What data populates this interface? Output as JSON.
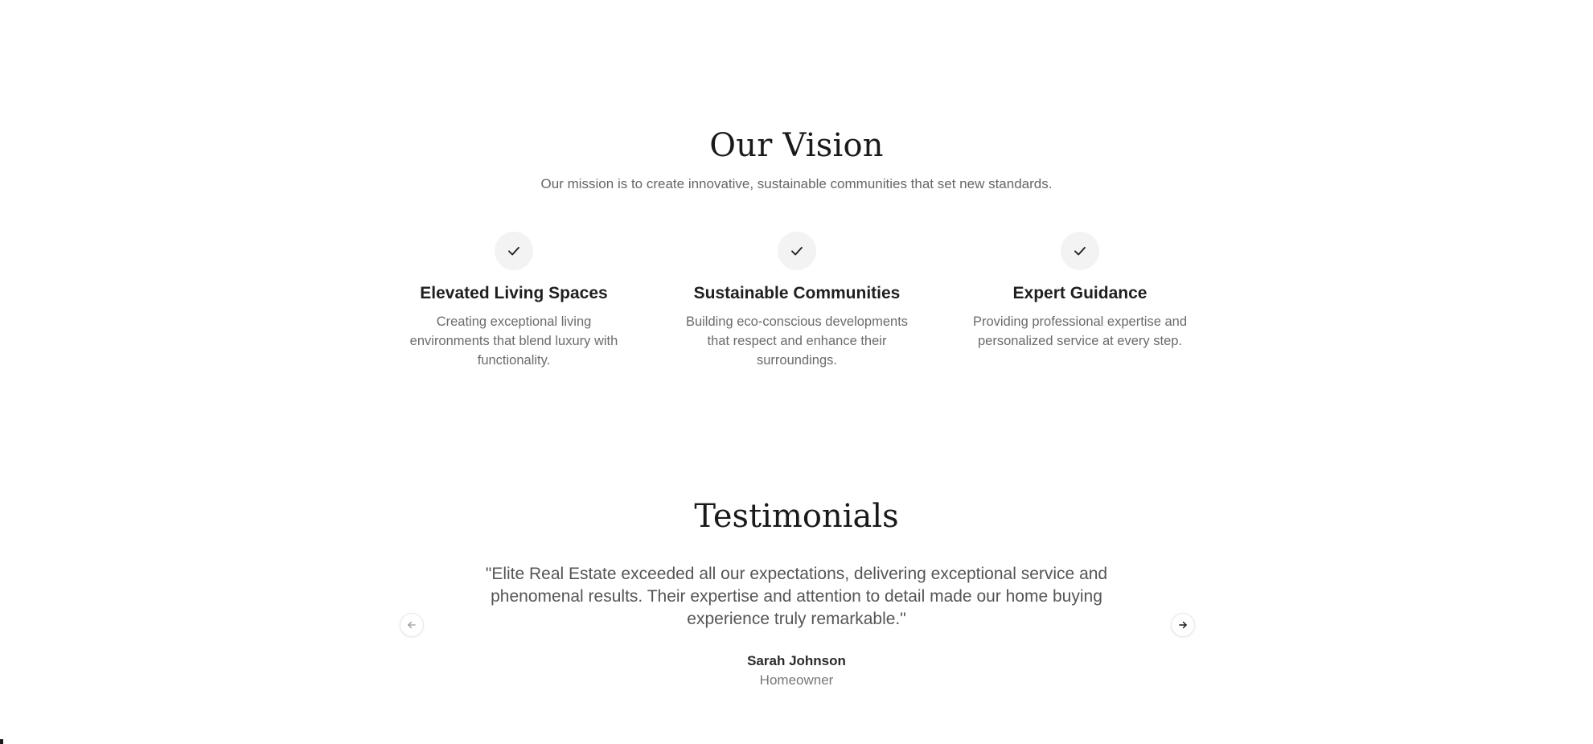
{
  "vision": {
    "title": "Our Vision",
    "subtitle": "Our mission is to create innovative, sustainable communities that set new standards.",
    "features": [
      {
        "icon": "check-icon",
        "title": "Elevated Living Spaces",
        "description": "Creating exceptional living environments that blend luxury with functionality."
      },
      {
        "icon": "check-icon",
        "title": "Sustainable Communities",
        "description": "Building eco-conscious developments that respect and enhance their surroundings."
      },
      {
        "icon": "check-icon",
        "title": "Expert Guidance",
        "description": "Providing professional expertise and personalized service at every step."
      }
    ]
  },
  "testimonials": {
    "title": "Testimonials",
    "quote": "\"Elite Real Estate exceeded all our expectations, delivering exceptional service and phenomenal results. Their expertise and attention to detail made our home buying experience truly remarkable.\"",
    "author_name": "Sarah Johnson",
    "author_role": "Homeowner",
    "prev_icon": "arrow-left-icon",
    "next_icon": "arrow-right-icon"
  },
  "colors": {
    "heading": "#1a1a1a",
    "muted_text": "#6b6b6b",
    "icon_circle_bg": "#f3f3f3"
  }
}
